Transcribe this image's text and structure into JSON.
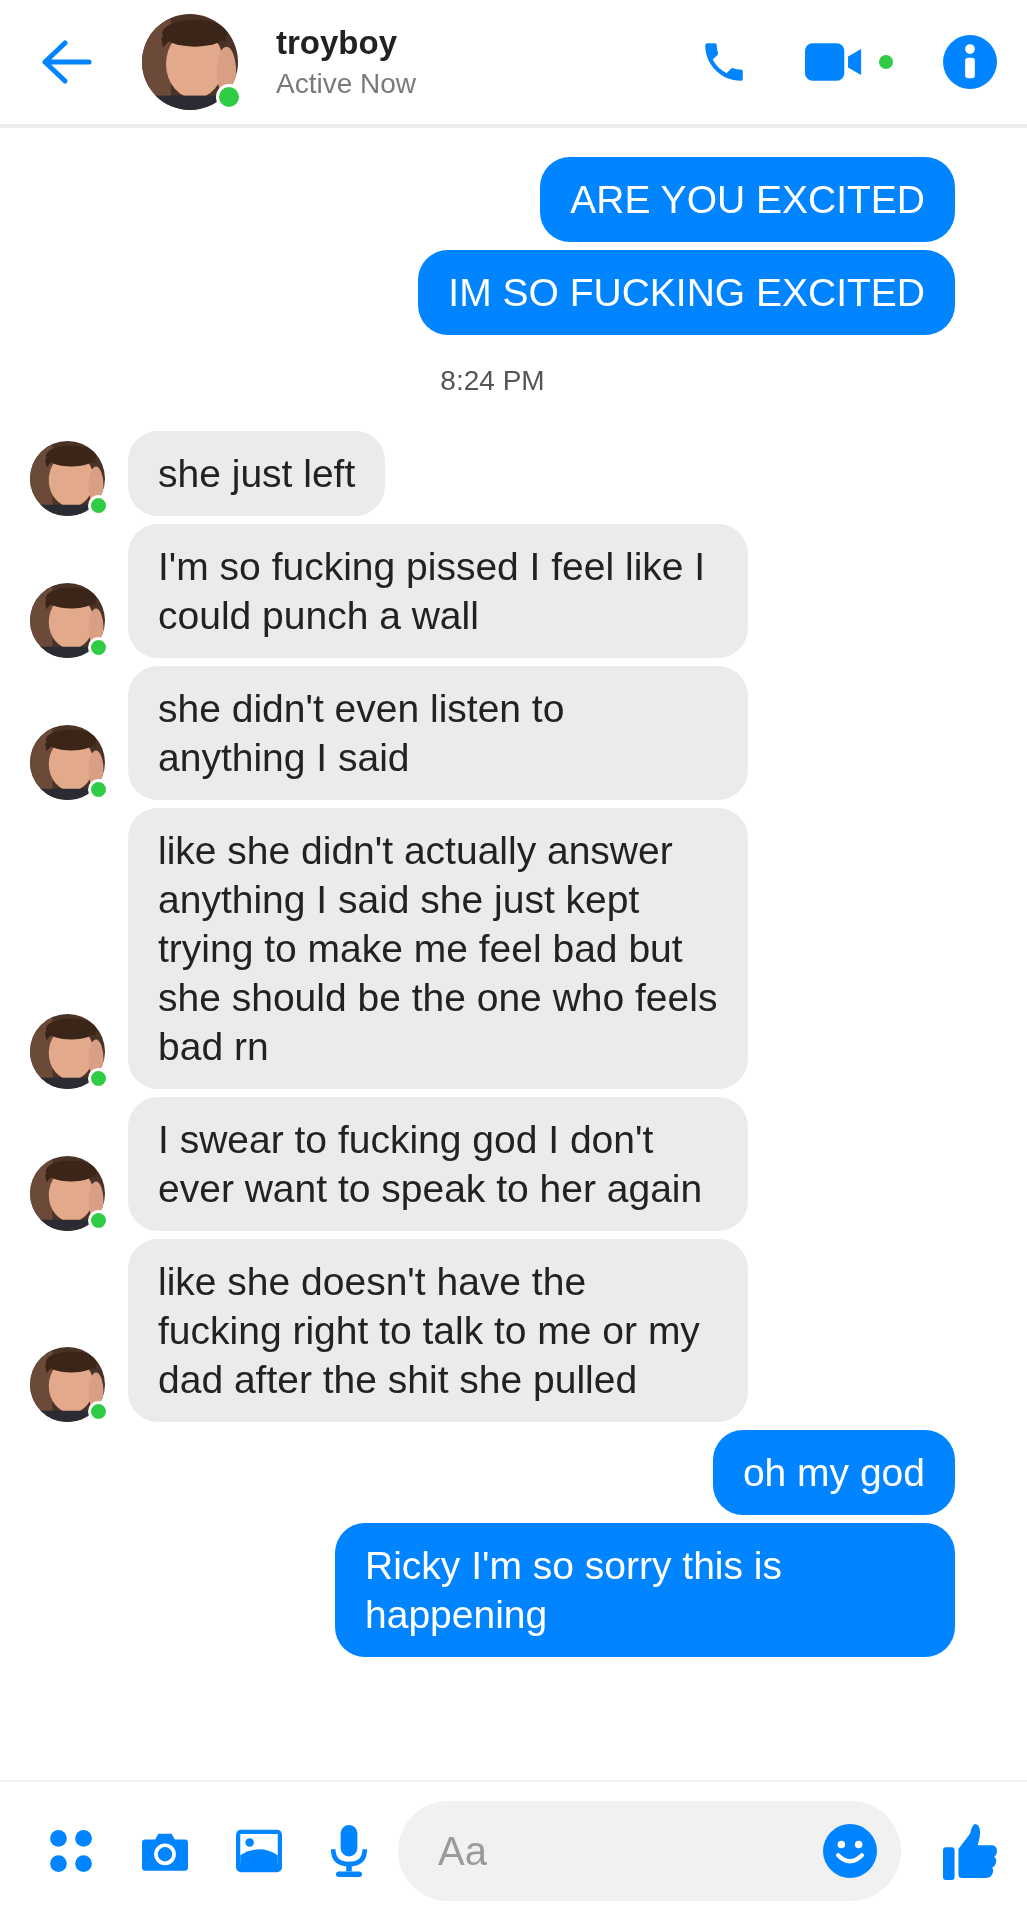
{
  "header": {
    "name": "troyboy",
    "status": "Active Now",
    "online": true,
    "video_online": true
  },
  "messages": [
    {
      "kind": "sent",
      "text": "ARE YOU EXCITED"
    },
    {
      "kind": "sent",
      "text": "IM SO FUCKING EXCITED"
    },
    {
      "kind": "timestamp",
      "text": "8:24 PM"
    },
    {
      "kind": "received",
      "text": "she just left",
      "online": true
    },
    {
      "kind": "received",
      "text": "I'm so fucking pissed I feel like I could punch a wall",
      "online": true
    },
    {
      "kind": "received",
      "text": "she didn't even listen to anything I said",
      "online": true
    },
    {
      "kind": "received",
      "text": "like she didn't actually answer anything I said she just kept trying to make me feel bad but she should be the one who feels bad rn",
      "online": true
    },
    {
      "kind": "received",
      "text": "I swear to fucking god I don't ever want to speak to her again",
      "online": true
    },
    {
      "kind": "received",
      "text": "like she doesn't have the fucking right to talk to me or my dad after the shit she pulled",
      "online": true
    },
    {
      "kind": "sent",
      "text": "oh my god"
    },
    {
      "kind": "sent",
      "text": "Ricky I'm so sorry this is happening"
    }
  ],
  "composer": {
    "placeholder": "Aa"
  }
}
